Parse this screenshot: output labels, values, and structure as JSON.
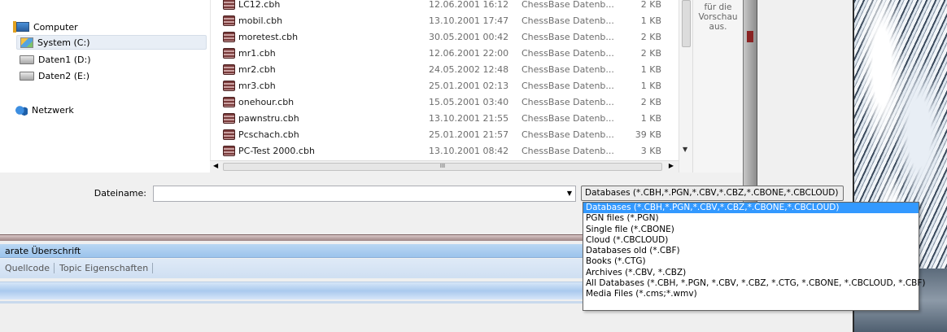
{
  "nav": {
    "items": [
      {
        "label": "Computer",
        "icon": "computer-icon"
      },
      {
        "label": "System (C:)",
        "icon": "system-drive-icon",
        "selected": true
      },
      {
        "label": "Daten1 (D:)",
        "icon": "drive-icon"
      },
      {
        "label": "Daten2 (E:)",
        "icon": "drive-icon"
      },
      {
        "label": "Netzwerk",
        "icon": "network-icon"
      }
    ]
  },
  "files": [
    {
      "name": "LC12.cbh",
      "date": "12.06.2001 16:12",
      "type": "ChessBase Datenb...",
      "size": "2 KB"
    },
    {
      "name": "mobil.cbh",
      "date": "13.10.2001 17:47",
      "type": "ChessBase Datenb...",
      "size": "1 KB"
    },
    {
      "name": "moretest.cbh",
      "date": "30.05.2001 00:42",
      "type": "ChessBase Datenb...",
      "size": "2 KB"
    },
    {
      "name": "mr1.cbh",
      "date": "12.06.2001 22:00",
      "type": "ChessBase Datenb...",
      "size": "2 KB"
    },
    {
      "name": "mr2.cbh",
      "date": "24.05.2002 12:48",
      "type": "ChessBase Datenb...",
      "size": "1 KB"
    },
    {
      "name": "mr3.cbh",
      "date": "25.01.2001 02:13",
      "type": "ChessBase Datenb...",
      "size": "1 KB"
    },
    {
      "name": "onehour.cbh",
      "date": "15.05.2001 03:40",
      "type": "ChessBase Datenb...",
      "size": "2 KB"
    },
    {
      "name": "pawnstru.cbh",
      "date": "13.10.2001 21:55",
      "type": "ChessBase Datenb...",
      "size": "1 KB"
    },
    {
      "name": "Pcschach.cbh",
      "date": "25.01.2001 21:57",
      "type": "ChessBase Datenb...",
      "size": "39 KB"
    },
    {
      "name": "PC-Test 2000.cbh",
      "date": "13.10.2001 08:42",
      "type": "ChessBase Datenb...",
      "size": "3 KB"
    }
  ],
  "preview": {
    "lines": [
      "für die",
      "Vorschau",
      "aus."
    ]
  },
  "hscroll": {
    "thumb_grip": "III"
  },
  "filename": {
    "label": "Dateiname:",
    "value": ""
  },
  "filter": {
    "selected": "Databases (*.CBH,*.PGN,*.CBV,*.CBZ,*.CBONE,*.CBCLOUD)",
    "options": [
      "Databases (*.CBH,*.PGN,*.CBV,*.CBZ,*.CBONE,*.CBCLOUD)",
      "PGN files (*.PGN)",
      "Single file (*.CBONE)",
      "Cloud (*.CBCLOUD)",
      "Databases old (*.CBF)",
      "Books (*.CTG)",
      "Archives (*.CBV, *.CBZ)",
      "All Databases (*.CBH, *.PGN, *.CBV, *.CBZ, *.CTG, *.CBONE, *.CBCLOUD, *.CBF)",
      "Media Files (*.cms;*.wmv)"
    ]
  },
  "lower": {
    "caption": "arate Überschrift",
    "tabs": [
      "Quellcode",
      "Topic Eigenschaften"
    ]
  },
  "colors": {
    "selection": "#3399ff",
    "caption_blue": "#9cc3ec"
  }
}
